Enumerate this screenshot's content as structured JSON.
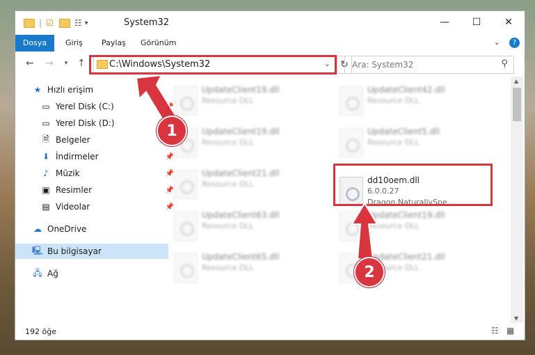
{
  "window": {
    "title": "System32"
  },
  "ribbon": {
    "tabs": [
      "Dosya",
      "Giriş",
      "Paylaş",
      "Görünüm"
    ]
  },
  "address": {
    "path": "C:\\Windows\\System32"
  },
  "search": {
    "placeholder": "Ara: System32"
  },
  "sidebar": {
    "items": [
      {
        "label": "Hızlı erişim",
        "icon": "star-icon"
      },
      {
        "label": "Yerel Disk (C:)",
        "icon": "drive-icon"
      },
      {
        "label": "Yerel Disk (D:)",
        "icon": "drive-icon"
      },
      {
        "label": "Belgeler",
        "icon": "document-icon"
      },
      {
        "label": "İndirmeler",
        "icon": "download-icon"
      },
      {
        "label": "Müzik",
        "icon": "music-icon"
      },
      {
        "label": "Resimler",
        "icon": "picture-icon"
      },
      {
        "label": "Videolar",
        "icon": "video-icon"
      },
      {
        "label": "OneDrive",
        "icon": "cloud-icon"
      },
      {
        "label": "Bu bilgisayar",
        "icon": "computer-icon"
      },
      {
        "label": "Ağ",
        "icon": "network-icon"
      }
    ]
  },
  "files": {
    "left": [
      {
        "name": "UpdateClient19.dll",
        "type": "Resource DLL"
      },
      {
        "name": "UpdateClient19.dll",
        "type": "Resource DLL"
      },
      {
        "name": "UpdateClient21.dll",
        "type": "Resource DLL"
      },
      {
        "name": "UpdateClient63.dll",
        "type": "Resource DLL"
      },
      {
        "name": "UpdateClient65.dll",
        "type": "Resource DLL"
      }
    ],
    "right": [
      {
        "name": "UpdateClient42.dll",
        "type": "Resource DLL"
      },
      {
        "name": "UpdateClient5.dll",
        "type": "Resource DLL"
      },
      {
        "name": "UpdateClient19.dll",
        "type": "Resource DLL"
      },
      {
        "name": "UpdateClient21.dll",
        "type": "Resource DLL"
      }
    ],
    "highlighted": {
      "name": "dd10oem.dll",
      "version": "6.0.0.27",
      "company": "Dragon NaturallySpe..."
    }
  },
  "status": {
    "count": "192 öğe"
  },
  "markers": {
    "one": "1",
    "two": "2"
  },
  "colors": {
    "accent": "#1979ca",
    "highlight": "#d9353f"
  }
}
